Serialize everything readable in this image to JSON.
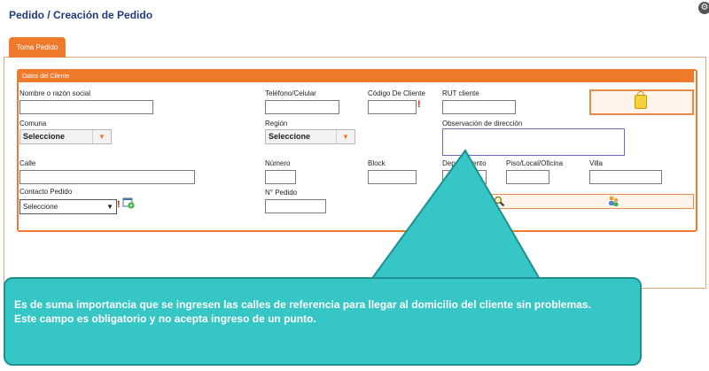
{
  "page": {
    "title": "Pedido / Creación de Pedido"
  },
  "tabs": [
    {
      "label": "Toma Pedido"
    }
  ],
  "panel": {
    "header": "Datos del Cliente"
  },
  "fields": {
    "nombre": "Nombre o razón social",
    "telefono": "Teléfono/Celular",
    "codigo": "Código De Cliente",
    "rut": "RUT cliente",
    "comuna": "Comuna",
    "comuna_value": "Seleccione",
    "region": "Región",
    "region_value": "Seleccione",
    "observacion": "Observación de dirección",
    "calle": "Calle",
    "numero": "Número",
    "block": "Block",
    "departamento": "Departamento",
    "departamento_visible": "Dep",
    "departamento_tail": "ento",
    "piso": "Piso/Local/Oficina",
    "villa": "Villa",
    "contacto": "Contacto Pedido",
    "contacto_value": "Seleccione",
    "n_pedido": "N° Pedido"
  },
  "markers": {
    "required": "!"
  },
  "icons": {
    "lock": "lock-icon",
    "add_contact": "add-contact-icon",
    "search": "search-icon",
    "users": "users-icon",
    "gear": "gear-icon"
  },
  "callout": {
    "text": "Es de suma importancia que se ingresen las calles de referencia para llegar al domicilio del cliente sin problemas.",
    "text2": "Este campo es obligatorio y no acepta ingreso de un punto."
  },
  "colors": {
    "accent": "#f07a2c",
    "callout": "#36c6c6",
    "title": "#1f3a7a",
    "required": "#e01010"
  }
}
